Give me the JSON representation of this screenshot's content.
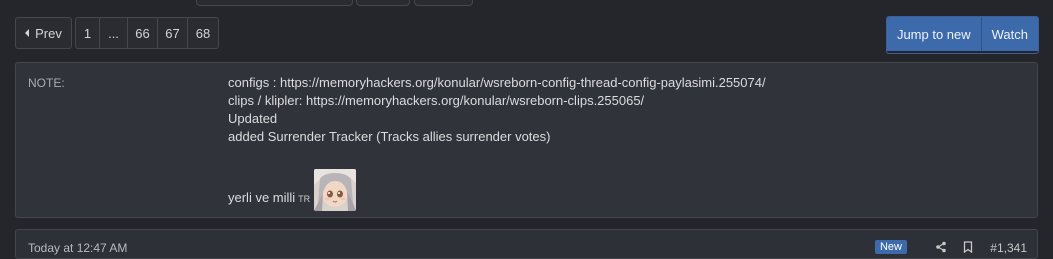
{
  "pagination": {
    "prev_label": "Prev",
    "pages": [
      "1",
      "...",
      "66",
      "67",
      "68"
    ]
  },
  "actions": {
    "jump_label": "Jump to new",
    "watch_label": "Watch"
  },
  "note": {
    "label": "NOTE:",
    "lines": [
      "configs : https://memoryhackers.org/konular/wsreborn-config-thread-config-paylasimi.255074/",
      "clips / klipler: https://memoryhackers.org/konular/wsreborn-clips.255065/",
      "Updated",
      "added Surrender Tracker (Tracks allies surrender votes)"
    ],
    "signature": "yerli ve milli",
    "flag": "TR"
  },
  "post": {
    "date": "Today at 12:47 AM",
    "badge": "New",
    "number": "#1,341"
  },
  "colors": {
    "accent": "#3d6aaa",
    "background": "#25262b",
    "panel": "#30333a"
  }
}
